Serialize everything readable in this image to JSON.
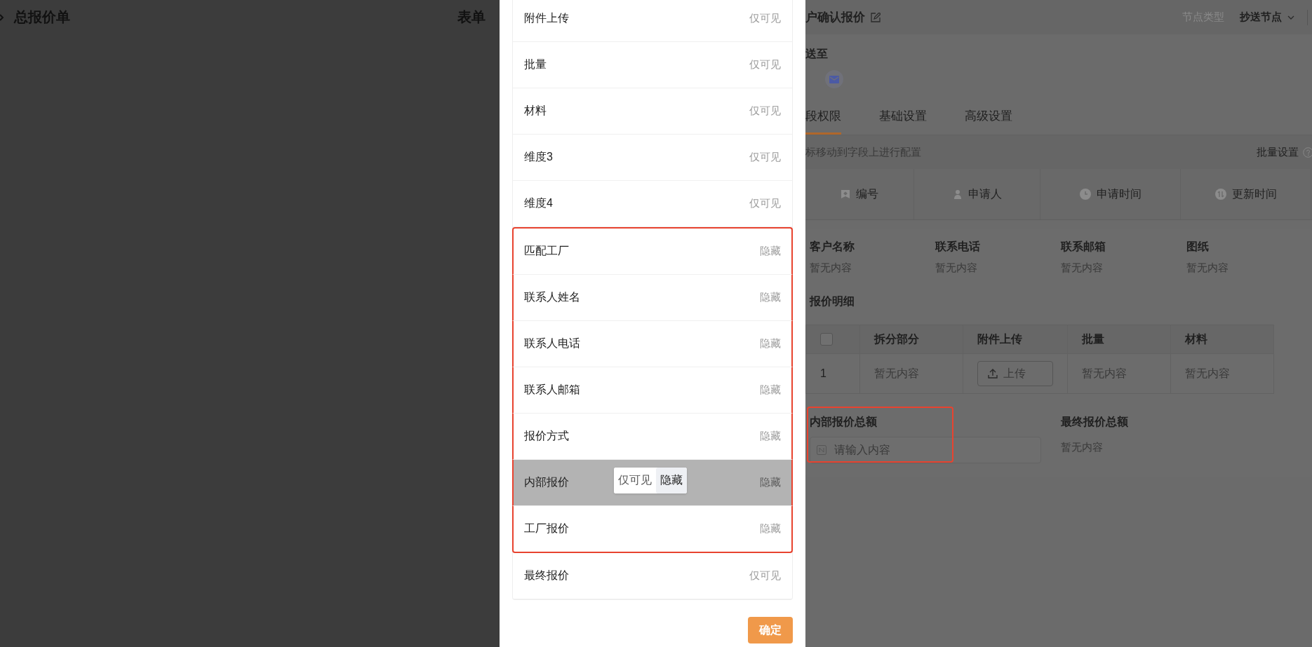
{
  "header": {
    "title": "总报价单",
    "center_title": "表单",
    "node_title": "户确认报价",
    "node_type_label": "节点类型",
    "node_type_value": "抄送节点"
  },
  "modal": {
    "fields": [
      {
        "name": "附件上传",
        "permission": "仅可见",
        "highlighted": false,
        "selected": false
      },
      {
        "name": "批量",
        "permission": "仅可见",
        "highlighted": false,
        "selected": false
      },
      {
        "name": "材料",
        "permission": "仅可见",
        "highlighted": false,
        "selected": false
      },
      {
        "name": "维度3",
        "permission": "仅可见",
        "highlighted": false,
        "selected": false
      },
      {
        "name": "维度4",
        "permission": "仅可见",
        "highlighted": false,
        "selected": false
      },
      {
        "name": "匹配工厂",
        "permission": "隐藏",
        "highlighted": true,
        "selected": false
      },
      {
        "name": "联系人姓名",
        "permission": "隐藏",
        "highlighted": true,
        "selected": false
      },
      {
        "name": "联系人电话",
        "permission": "隐藏",
        "highlighted": true,
        "selected": false
      },
      {
        "name": "联系人邮箱",
        "permission": "隐藏",
        "highlighted": true,
        "selected": false
      },
      {
        "name": "报价方式",
        "permission": "隐藏",
        "highlighted": true,
        "selected": false
      },
      {
        "name": "内部报价",
        "permission": "隐藏",
        "highlighted": true,
        "selected": true,
        "options": [
          {
            "label": "仅可见",
            "selected": false
          },
          {
            "label": "隐藏",
            "selected": true
          }
        ]
      },
      {
        "name": "工厂报价",
        "permission": "隐藏",
        "highlighted": true,
        "selected": false
      },
      {
        "name": "最终报价",
        "permission": "仅可见",
        "highlighted": false,
        "selected": false
      }
    ],
    "confirm_button": "确定"
  },
  "panel": {
    "cc_label": "送至",
    "tabs": [
      {
        "label": "段权限",
        "selected": true
      },
      {
        "label": "基础设置",
        "selected": false
      },
      {
        "label": "高级设置",
        "selected": false
      }
    ],
    "hint": "标移动到字段上进行配置",
    "batch_setting": "批量设置",
    "system_fields": [
      {
        "label": "编号",
        "kind": "tag"
      },
      {
        "label": "申请人",
        "kind": "person"
      },
      {
        "label": "申请时间",
        "kind": "clock"
      },
      {
        "label": "更新时间",
        "kind": "refresh"
      }
    ],
    "fields": [
      {
        "label": "客户名称",
        "value": "暂无内容"
      },
      {
        "label": "联系电话",
        "value": "暂无内容"
      },
      {
        "label": "联系邮箱",
        "value": "暂无内容"
      },
      {
        "label": "图纸",
        "value": "暂无内容"
      }
    ],
    "detail": {
      "title": "报价明细",
      "select_all_checked": false,
      "columns": [
        "拆分部分",
        "附件上传",
        "批量",
        "材料"
      ],
      "rows": [
        {
          "index": "1",
          "cells": [
            {
              "kind": "text",
              "text": "暂无内容"
            },
            {
              "kind": "upload",
              "text": "上传"
            },
            {
              "kind": "text",
              "text": "暂无内容"
            },
            {
              "kind": "text",
              "text": "暂无内容"
            }
          ]
        }
      ]
    },
    "totals": [
      {
        "label": "内部报价总额",
        "kind": "input",
        "placeholder": "请输入内容",
        "highlighted": true
      },
      {
        "label": "最终报价总额",
        "kind": "text",
        "value": "暂无内容"
      }
    ]
  }
}
